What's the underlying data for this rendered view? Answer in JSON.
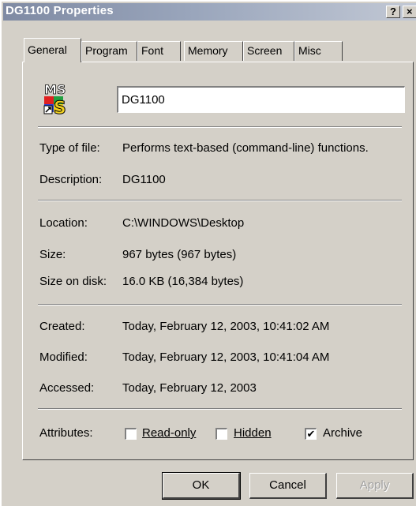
{
  "window": {
    "title": "DG1100 Properties",
    "help_label": "?",
    "close_label": "×"
  },
  "tabs": [
    {
      "label": "General",
      "active": true
    },
    {
      "label": "Program"
    },
    {
      "label": "Font"
    },
    {
      "label": "Memory"
    },
    {
      "label": "Screen"
    },
    {
      "label": "Misc"
    }
  ],
  "file": {
    "icon": "ms-dos-program-icon",
    "name": "DG1100"
  },
  "details": {
    "type_label": "Type of file:",
    "type_value": "Performs text-based (command-line) functions.",
    "description_label": "Description:",
    "description_value": "DG1100",
    "location_label": "Location:",
    "location_value": "C:\\WINDOWS\\Desktop",
    "size_label": "Size:",
    "size_value": "967 bytes (967 bytes)",
    "size_on_disk_label": "Size on disk:",
    "size_on_disk_value": "16.0 KB (16,384 bytes)",
    "created_label": "Created:",
    "created_value": "Today, February 12, 2003, 10:41:02 AM",
    "modified_label": "Modified:",
    "modified_value": "Today, February 12, 2003, 10:41:04 AM",
    "accessed_label": "Accessed:",
    "accessed_value": "Today, February 12, 2003"
  },
  "attributes": {
    "label": "Attributes:",
    "read_only": {
      "label": "Read-only",
      "checked": false,
      "check_mark": ""
    },
    "hidden": {
      "label": "Hidden",
      "checked": false,
      "check_mark": ""
    },
    "archive": {
      "label": "Archive",
      "checked": true,
      "check_mark": "✔"
    }
  },
  "buttons": {
    "ok": "OK",
    "cancel": "Cancel",
    "apply": "Apply"
  },
  "colors": {
    "face": "#d4d0c8",
    "title_start": "#7f8aa3",
    "title_end": "#c4cad6"
  }
}
